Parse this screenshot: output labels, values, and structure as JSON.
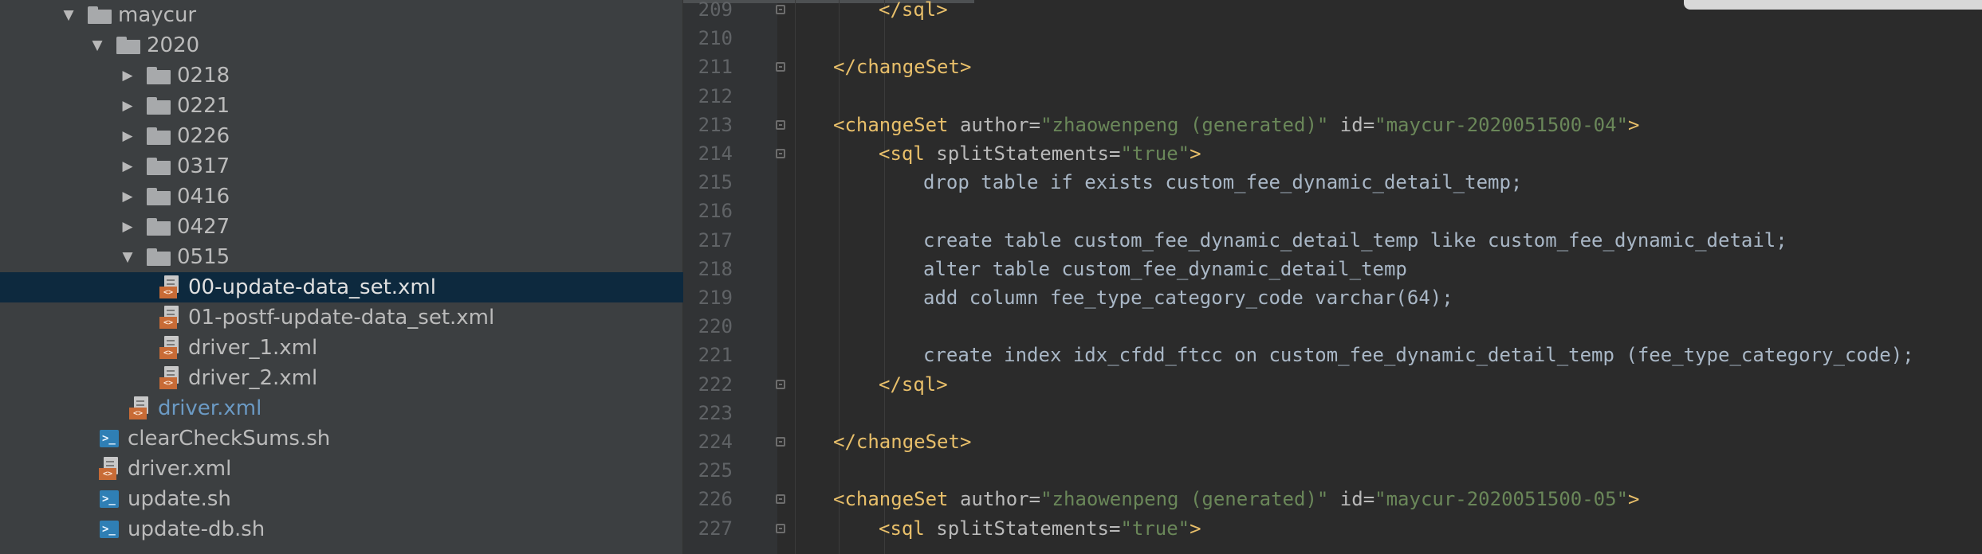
{
  "tree": {
    "items": [
      {
        "id": "maycur",
        "label": "maycur",
        "type": "folder",
        "expanded": true,
        "depth": 0
      },
      {
        "id": "2020",
        "label": "2020",
        "type": "folder",
        "expanded": true,
        "depth": 1
      },
      {
        "id": "0218",
        "label": "0218",
        "type": "folder",
        "expanded": false,
        "depth": 2
      },
      {
        "id": "0221",
        "label": "0221",
        "type": "folder",
        "expanded": false,
        "depth": 2
      },
      {
        "id": "0226",
        "label": "0226",
        "type": "folder",
        "expanded": false,
        "depth": 2
      },
      {
        "id": "0317",
        "label": "0317",
        "type": "folder",
        "expanded": false,
        "depth": 2
      },
      {
        "id": "0416",
        "label": "0416",
        "type": "folder",
        "expanded": false,
        "depth": 2
      },
      {
        "id": "0427",
        "label": "0427",
        "type": "folder",
        "expanded": false,
        "depth": 2
      },
      {
        "id": "0515",
        "label": "0515",
        "type": "folder",
        "expanded": true,
        "depth": 2
      },
      {
        "id": "f00",
        "label": "00-update-data_set.xml",
        "type": "xml",
        "depth": 3,
        "selected": true
      },
      {
        "id": "f01",
        "label": "01-postf-update-data_set.xml",
        "type": "xml",
        "depth": 3
      },
      {
        "id": "fd1",
        "label": "driver_1.xml",
        "type": "xml",
        "depth": 3
      },
      {
        "id": "fd2",
        "label": "driver_2.xml",
        "type": "xml",
        "depth": 3
      },
      {
        "id": "fdrv",
        "label": "driver.xml",
        "type": "xml",
        "depth": 2,
        "link": true
      },
      {
        "id": "clr",
        "label": "clearCheckSums.sh",
        "type": "sh",
        "depth": 1
      },
      {
        "id": "drv2",
        "label": "driver.xml",
        "type": "xml",
        "depth": 1
      },
      {
        "id": "upd",
        "label": "update.sh",
        "type": "sh",
        "depth": 1
      },
      {
        "id": "upddb",
        "label": "update-db.sh",
        "type": "sh",
        "depth": 1
      }
    ]
  },
  "editor": {
    "lines": [
      {
        "n": "209",
        "fold": true,
        "indent": 2,
        "tokens": [
          {
            "t": "tag",
            "v": "</sql>"
          }
        ]
      },
      {
        "n": "210",
        "fold": false,
        "indent": 0,
        "tokens": []
      },
      {
        "n": "211",
        "fold": true,
        "indent": 1,
        "tokens": [
          {
            "t": "tag",
            "v": "</changeSet>"
          }
        ]
      },
      {
        "n": "212",
        "fold": false,
        "indent": 0,
        "tokens": []
      },
      {
        "n": "213",
        "fold": true,
        "indent": 1,
        "tokens": [
          {
            "t": "tag",
            "v": "<changeSet "
          },
          {
            "t": "attr",
            "v": "author="
          },
          {
            "t": "str",
            "v": "\"zhaowenpeng (generated)\""
          },
          {
            "t": "attr",
            "v": " id="
          },
          {
            "t": "str",
            "v": "\"maycur-2020051500-04\""
          },
          {
            "t": "tag",
            "v": ">"
          }
        ]
      },
      {
        "n": "214",
        "fold": true,
        "indent": 2,
        "tokens": [
          {
            "t": "tag",
            "v": "<sql "
          },
          {
            "t": "attr",
            "v": "splitStatements="
          },
          {
            "t": "str",
            "v": "\"true\""
          },
          {
            "t": "tag",
            "v": ">"
          }
        ]
      },
      {
        "n": "215",
        "fold": false,
        "indent": 3,
        "tokens": [
          {
            "t": "plain",
            "v": "drop table if exists custom_fee_dynamic_detail_temp;"
          }
        ]
      },
      {
        "n": "216",
        "fold": false,
        "indent": 0,
        "tokens": []
      },
      {
        "n": "217",
        "fold": false,
        "indent": 3,
        "tokens": [
          {
            "t": "plain",
            "v": "create table custom_fee_dynamic_detail_temp like custom_fee_dynamic_detail;"
          }
        ]
      },
      {
        "n": "218",
        "fold": false,
        "indent": 3,
        "tokens": [
          {
            "t": "plain",
            "v": "alter table custom_fee_dynamic_detail_temp"
          }
        ]
      },
      {
        "n": "219",
        "fold": false,
        "indent": 3,
        "tokens": [
          {
            "t": "plain",
            "v": "add column fee_type_category_code varchar(64);"
          }
        ]
      },
      {
        "n": "220",
        "fold": false,
        "indent": 0,
        "tokens": []
      },
      {
        "n": "221",
        "fold": false,
        "indent": 3,
        "tokens": [
          {
            "t": "plain",
            "v": "create index idx_cfdd_ftcc on custom_fee_dynamic_detail_temp (fee_type_category_code);"
          }
        ]
      },
      {
        "n": "222",
        "fold": true,
        "indent": 2,
        "tokens": [
          {
            "t": "tag",
            "v": "</sql>"
          }
        ]
      },
      {
        "n": "223",
        "fold": false,
        "indent": 0,
        "tokens": []
      },
      {
        "n": "224",
        "fold": true,
        "indent": 1,
        "tokens": [
          {
            "t": "tag",
            "v": "</changeSet>"
          }
        ]
      },
      {
        "n": "225",
        "fold": false,
        "indent": 0,
        "tokens": []
      },
      {
        "n": "226",
        "fold": true,
        "indent": 1,
        "tokens": [
          {
            "t": "tag",
            "v": "<changeSet "
          },
          {
            "t": "attr",
            "v": "author="
          },
          {
            "t": "str",
            "v": "\"zhaowenpeng (generated)\""
          },
          {
            "t": "attr",
            "v": " id="
          },
          {
            "t": "str",
            "v": "\"maycur-2020051500-05\""
          },
          {
            "t": "tag",
            "v": ">"
          }
        ]
      },
      {
        "n": "227",
        "fold": true,
        "indent": 2,
        "tokens": [
          {
            "t": "tag",
            "v": "<sql "
          },
          {
            "t": "attr",
            "v": "splitStatements="
          },
          {
            "t": "str",
            "v": "\"true\""
          },
          {
            "t": "tag",
            "v": ">"
          }
        ]
      }
    ]
  }
}
